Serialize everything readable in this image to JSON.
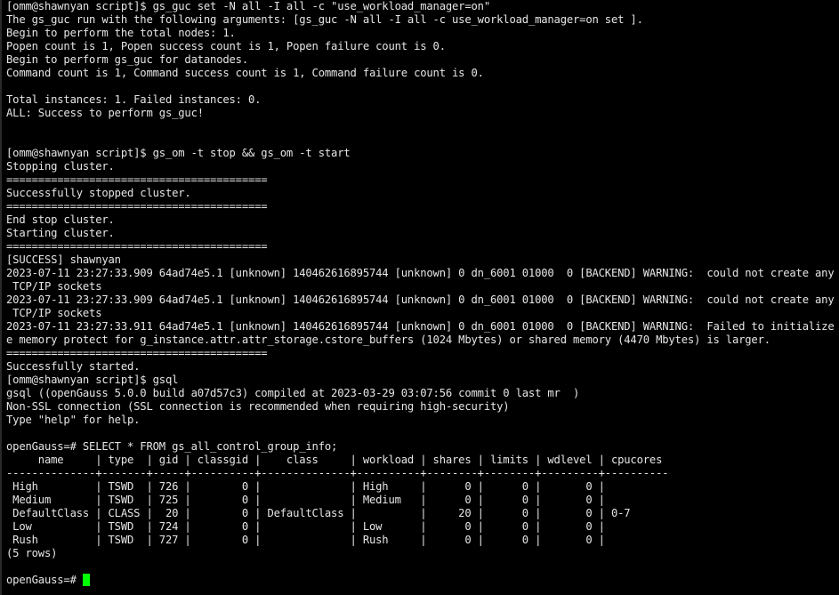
{
  "terminal": {
    "cursor_color": "#00ff00",
    "background_color": "#000000",
    "text_color": "#e6e6e6",
    "lines": [
      "[omm@shawnyan script]$ gs_guc set -N all -I all -c \"use_workload_manager=on\"",
      "The gs_guc run with the following arguments: [gs_guc -N all -I all -c use_workload_manager=on set ].",
      "Begin to perform the total nodes: 1.",
      "Popen count is 1, Popen success count is 1, Popen failure count is 0.",
      "Begin to perform gs_guc for datanodes.",
      "Command count is 1, Command success count is 1, Command failure count is 0.",
      "",
      "Total instances: 1. Failed instances: 0.",
      "ALL: Success to perform gs_guc!",
      "",
      "",
      "[omm@shawnyan script]$ gs_om -t stop && gs_om -t start",
      "Stopping cluster.",
      "=========================================",
      "Successfully stopped cluster.",
      "=========================================",
      "End stop cluster.",
      "Starting cluster.",
      "=========================================",
      "[SUCCESS] shawnyan",
      "2023-07-11 23:27:33.909 64ad74e5.1 [unknown] 140462616895744 [unknown] 0 dn_6001 01000  0 [BACKEND] WARNING:  could not create any HA",
      " TCP/IP sockets",
      "2023-07-11 23:27:33.909 64ad74e5.1 [unknown] 140462616895744 [unknown] 0 dn_6001 01000  0 [BACKEND] WARNING:  could not create any HA",
      " TCP/IP sockets",
      "2023-07-11 23:27:33.911 64ad74e5.1 [unknown] 140462616895744 [unknown] 0 dn_6001 01000  0 [BACKEND] WARNING:  Failed to initialize th",
      "e memory protect for g_instance.attr.attr_storage.cstore_buffers (1024 Mbytes) or shared memory (4470 Mbytes) is larger.",
      "=========================================",
      "Successfully started.",
      "[omm@shawnyan script]$ gsql",
      "gsql ((openGauss 5.0.0 build a07d57c3) compiled at 2023-03-29 03:07:56 commit 0 last mr  )",
      "Non-SSL connection (SSL connection is recommended when requiring high-security)",
      "Type \"help\" for help.",
      "",
      "openGauss=# SELECT * FROM gs_all_control_group_info;",
      "     name     | type  | gid | classgid |    class     | workload | shares | limits | wdlevel | cpucores",
      "--------------+-------+-----+----------+--------------+----------+--------+--------+---------+----------",
      " High         | TSWD  | 726 |        0 |              | High     |      0 |      0 |       0 |",
      " Medium       | TSWD  | 725 |        0 |              | Medium   |      0 |      0 |       0 |",
      " DefaultClass | CLASS |  20 |        0 | DefaultClass |          |     20 |      0 |       0 | 0-7",
      " Low          | TSWD  | 724 |        0 |              | Low      |      0 |      0 |       0 |",
      " Rush         | TSWD  | 727 |        0 |              | Rush     |      0 |      0 |       0 |",
      "(5 rows)",
      ""
    ],
    "prompt": "openGauss=# ",
    "input_value": ""
  },
  "query_result": {
    "query": "SELECT * FROM gs_all_control_group_info;",
    "columns": [
      "name",
      "type",
      "gid",
      "classgid",
      "class",
      "workload",
      "shares",
      "limits",
      "wdlevel",
      "cpucores"
    ],
    "rows": [
      [
        "High",
        "TSWD",
        "726",
        "0",
        "",
        "High",
        "0",
        "0",
        "0",
        ""
      ],
      [
        "Medium",
        "TSWD",
        "725",
        "0",
        "",
        "Medium",
        "0",
        "0",
        "0",
        ""
      ],
      [
        "DefaultClass",
        "CLASS",
        "20",
        "0",
        "DefaultClass",
        "",
        "20",
        "0",
        "0",
        "0-7"
      ],
      [
        "Low",
        "TSWD",
        "724",
        "0",
        "",
        "Low",
        "0",
        "0",
        "0",
        ""
      ],
      [
        "Rush",
        "TSWD",
        "727",
        "0",
        "",
        "Rush",
        "0",
        "0",
        "0",
        ""
      ]
    ],
    "row_count_text": "(5 rows)"
  }
}
